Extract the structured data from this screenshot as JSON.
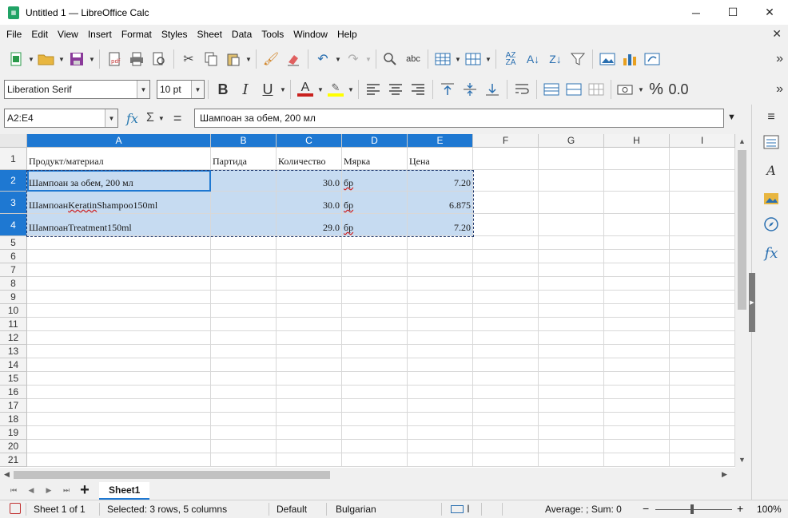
{
  "window": {
    "title": "Untitled 1 — LibreOffice Calc",
    "app_icon_text": "Calc",
    "minimize": "─",
    "maximize": "☐",
    "close": "✕"
  },
  "menu": {
    "items": [
      "File",
      "Edit",
      "View",
      "Insert",
      "Format",
      "Styles",
      "Sheet",
      "Data",
      "Tools",
      "Window",
      "Help"
    ],
    "close_doc": "✕"
  },
  "toolbar_standard": {
    "icons": [
      "new-spreadsheet-icon",
      "open-icon",
      "save-icon",
      "export-pdf-icon",
      "print-icon",
      "print-preview-icon",
      "cut-icon",
      "copy-icon",
      "paste-icon",
      "clone-formatting-icon",
      "clear-formatting-icon",
      "undo-icon",
      "redo-icon",
      "find-replace-icon",
      "spelling-icon",
      "row-icon",
      "column-icon",
      "sort-icon",
      "sort-ascending-icon",
      "sort-descending-icon",
      "autofilter-icon",
      "insert-image-icon",
      "insert-chart-icon",
      "pivot-table-icon"
    ],
    "more": "»"
  },
  "toolbar_formatting": {
    "font_name": "Liberation Serif",
    "font_size": "10 pt",
    "bold": "B",
    "italic": "I",
    "underline": "U",
    "font_color_letter": "A",
    "percent": "%",
    "decimal": "0.0",
    "more": "»"
  },
  "formula_bar": {
    "name_box": "A2:E4",
    "fx": "fx",
    "sum": "Σ",
    "equals": "=",
    "content": "Шампоан за обем, 200 мл"
  },
  "grid": {
    "columns": [
      "A",
      "B",
      "C",
      "D",
      "E",
      "F",
      "G",
      "H",
      "I"
    ],
    "row_numbers": [
      "1",
      "2",
      "3",
      "4",
      "5",
      "6",
      "7",
      "8",
      "9",
      "10",
      "11",
      "12",
      "13",
      "14",
      "15",
      "16",
      "17",
      "18",
      "19",
      "20",
      "21"
    ],
    "header_row": [
      "Продукт/материал",
      "Партида",
      "Количество",
      "Мярка",
      "Цена"
    ],
    "rows": [
      [
        "Шампоан за обем, 200 мл",
        "",
        "30.0",
        "бр",
        "7.20"
      ],
      [
        "Шампоан Keratin Shampoo 150ml",
        "",
        "30.0",
        "бр",
        "6.875"
      ],
      [
        "Шампоан Treatment 150ml",
        "",
        "29.0",
        "бр",
        "7.20"
      ]
    ]
  },
  "sheet_tabs": {
    "add": "+",
    "nav_first": "⏮",
    "nav_prev": "◀",
    "nav_next": "▶",
    "nav_last": "⏭",
    "active": "Sheet1"
  },
  "status": {
    "sheet_info": "Sheet 1 of 1",
    "selection": "Selected: 3 rows, 5 columns",
    "page_style": "Default",
    "language": "Bulgarian",
    "summary": "Average: ; Sum: 0",
    "zoom_out": "−",
    "zoom_in": "+",
    "zoom": "100%"
  },
  "sidebar": {
    "icons": [
      "menu-icon",
      "properties-icon",
      "styles-icon",
      "gallery-icon",
      "navigator-icon",
      "functions-icon"
    ]
  }
}
